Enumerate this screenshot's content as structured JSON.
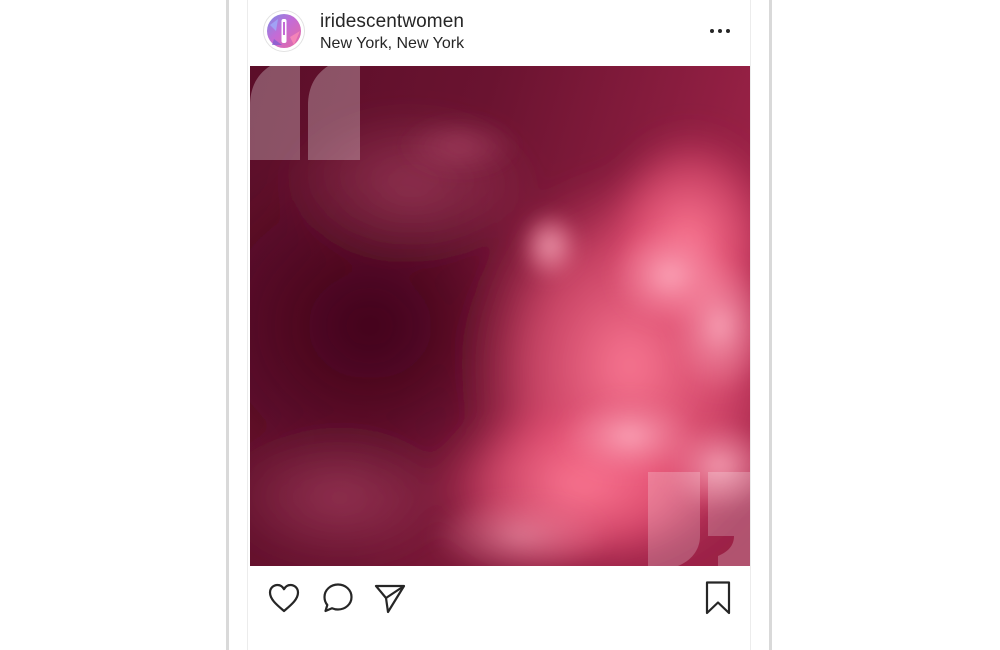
{
  "post": {
    "username": "iridescentwomen",
    "location": "New York, New York"
  },
  "icons": {
    "avatar": "iridescent-avatar",
    "more": "more-options-icon",
    "like": "heart-icon",
    "comment": "comment-icon",
    "share": "paper-plane-icon",
    "save": "bookmark-icon"
  },
  "colors": {
    "text": "#262626",
    "image_dark": "#5b0e29",
    "image_pink": "#f2607d",
    "frame": "#d9d9d9"
  }
}
